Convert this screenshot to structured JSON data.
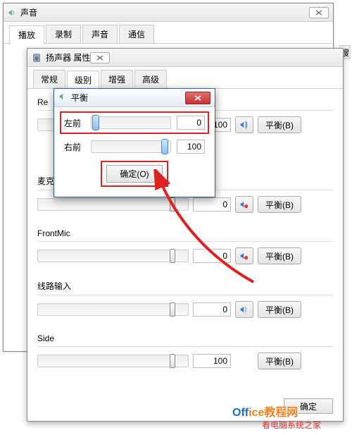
{
  "sound_window": {
    "title": "声音",
    "tabs": [
      "播放",
      "录制",
      "声音",
      "通信"
    ],
    "active_tab": 0
  },
  "search_btn": "搜",
  "speaker_window": {
    "title": "扬声器 属性",
    "tabs": [
      "常规",
      "级别",
      "增强",
      "高级"
    ],
    "active_tab": 1,
    "sections": [
      {
        "name": "Re",
        "label": "Re",
        "value": "100",
        "thumb_pct": 88,
        "balance_label": "平衡(B)",
        "muted": false
      },
      {
        "name": "mic",
        "label": "麦克风",
        "value": "0",
        "thumb_pct": 88,
        "balance_label": "平衡(B)",
        "muted": true
      },
      {
        "name": "frontmic",
        "label": "FrontMic",
        "value": "0",
        "thumb_pct": 88,
        "balance_label": "平衡(B)",
        "muted": true
      },
      {
        "name": "linein",
        "label": "线路输入",
        "value": "0",
        "thumb_pct": 88,
        "balance_label": "平衡(B)",
        "muted": false
      },
      {
        "name": "side",
        "label": "Side",
        "value": "100",
        "thumb_pct": 88,
        "balance_label": "平衡(B)",
        "muted": false,
        "hide_sound_btn": true
      }
    ],
    "footer": {
      "ok": "确定"
    }
  },
  "balance_dialog": {
    "title": "平衡",
    "rows": [
      {
        "label": "左前",
        "value": "0",
        "thumb_pct": 1
      },
      {
        "label": "右前",
        "value": "100",
        "thumb_pct": 88
      }
    ],
    "ok_label": "确定(O)"
  },
  "watermark1_a": "Off",
  "watermark1_b": "ice",
  "watermark1_c": "教程网",
  "watermark2": "看电脑系统之家"
}
